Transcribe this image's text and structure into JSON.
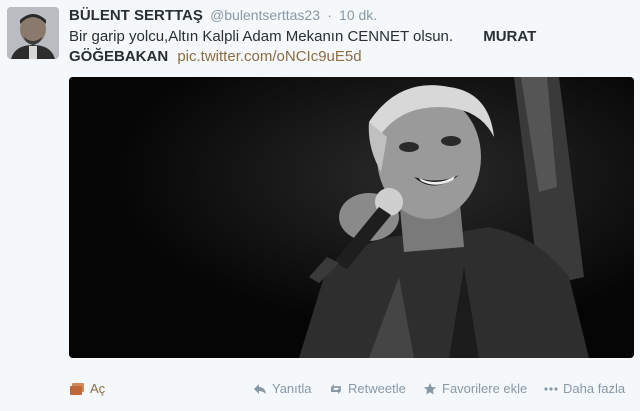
{
  "tweet": {
    "fullname": "BÜLENT SERTTAŞ",
    "username": "@bulentserttas23",
    "separator": "·",
    "time": "10 dk.",
    "text_main": "Bir garip yolcu,Altın Kalpli Adam Mekanın CENNET olsun.",
    "text_name_1": "MURAT",
    "text_name_2": "GÖĞEBAKAN",
    "link": "pic.twitter.com/oNCIc9uE5d"
  },
  "actions": {
    "open": "Aç",
    "reply": "Yanıtla",
    "retweet": "Retweetle",
    "favorite": "Favorilere ekle",
    "more": "Daha fazla"
  },
  "colors": {
    "background": "#f5f8fa",
    "link": "#8b6d43",
    "muted": "#8899a6",
    "text": "#292f33"
  },
  "icons": {
    "open": "media-icon",
    "reply": "reply-icon",
    "retweet": "retweet-icon",
    "favorite": "star-icon",
    "more": "ellipsis-icon"
  }
}
